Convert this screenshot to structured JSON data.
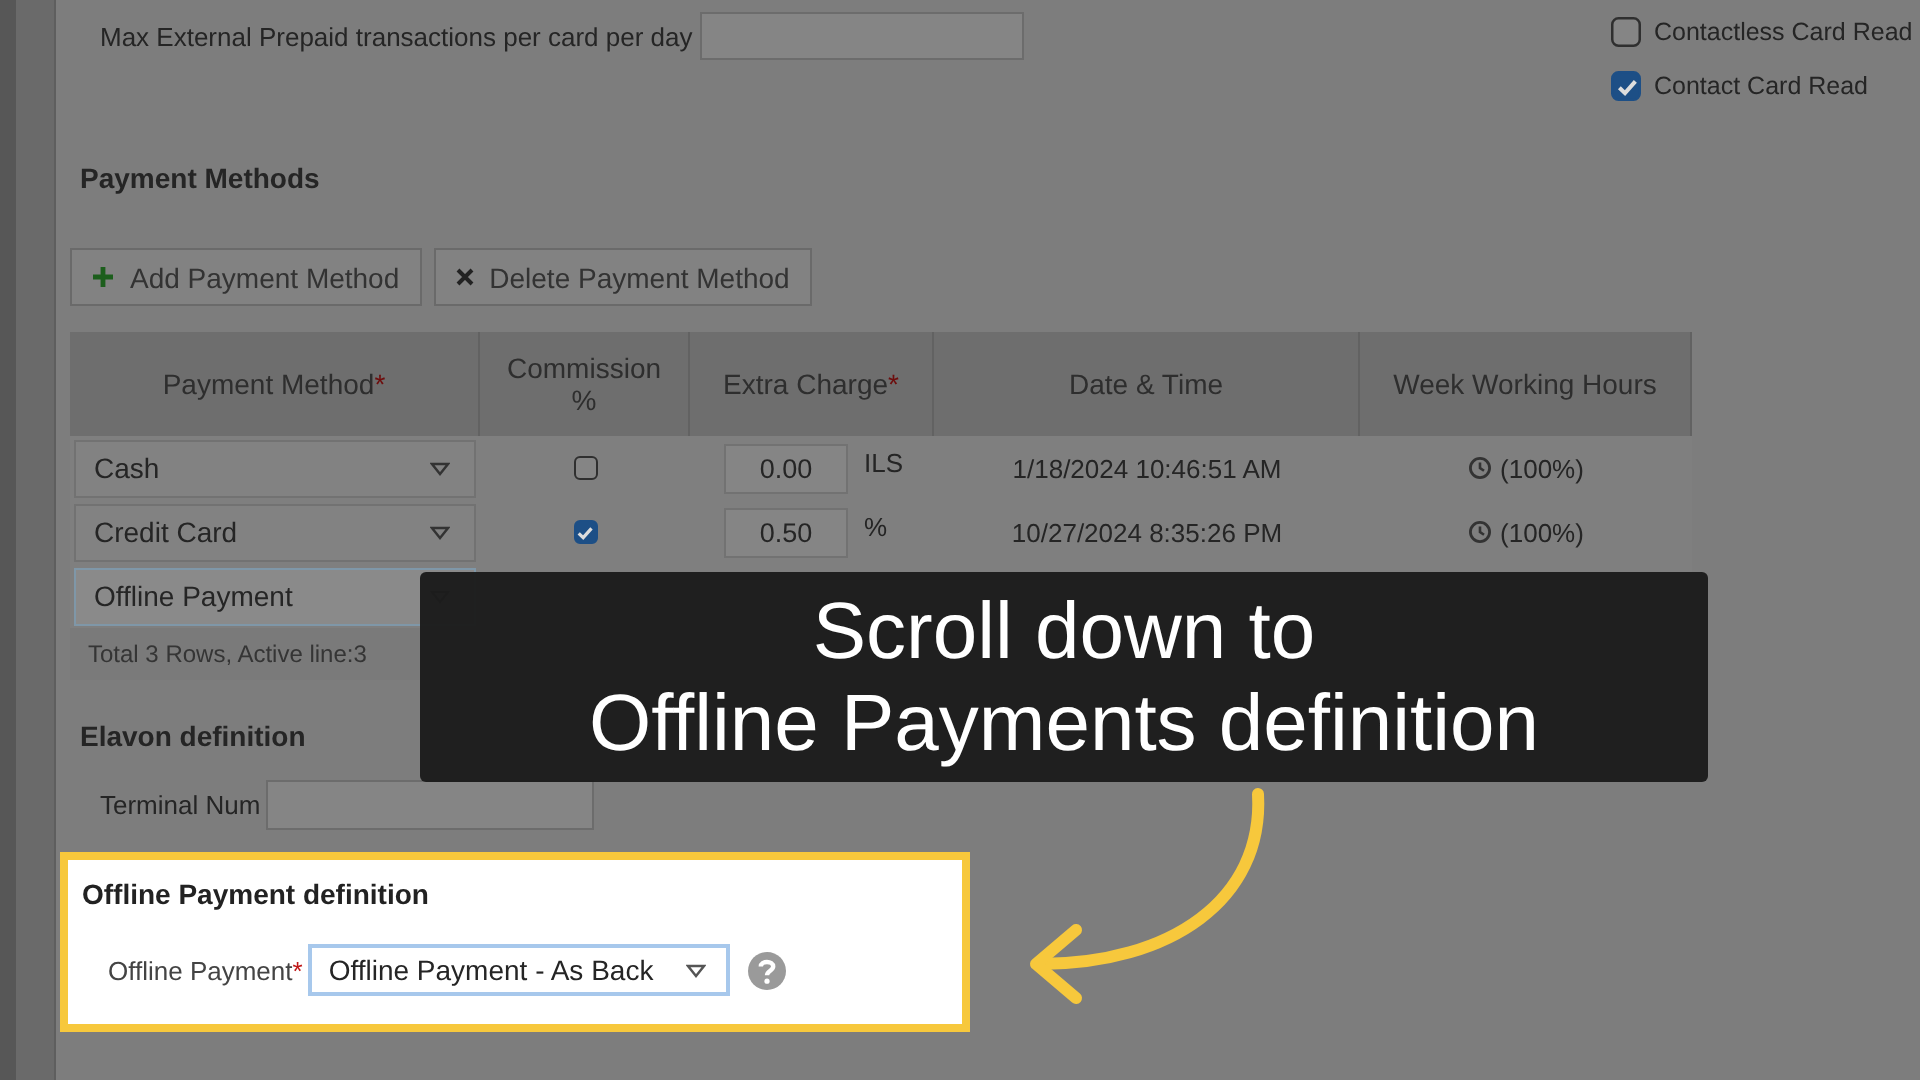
{
  "limits": {
    "label": "Max External Prepaid transactions per card per day"
  },
  "card_read_options": [
    {
      "label": "Contactless Card Read",
      "checked": false
    },
    {
      "label": "Contact Card Read",
      "checked": true
    }
  ],
  "payment_methods": {
    "title": "Payment Methods",
    "buttons": [
      {
        "label": "Add Payment Method",
        "kind": "add"
      },
      {
        "label": "Delete Payment Method",
        "kind": "delete"
      }
    ],
    "columns": [
      {
        "label": "Payment Method",
        "mark": "*"
      },
      {
        "label": "Commission %"
      },
      {
        "label": "Extra Charge",
        "mark": "*"
      },
      {
        "label": "Date & Time"
      },
      {
        "label": "Week Working Hours"
      }
    ],
    "rows": [
      {
        "method": "Cash",
        "commission": false,
        "extra_charge": "0.00",
        "unit": "ILS",
        "date_time": "1/18/2024 10:46:51 AM",
        "week_hours": "(100%)",
        "selected": false
      },
      {
        "method": "Credit Card",
        "commission": true,
        "extra_charge": "0.50",
        "unit": "%",
        "date_time": "10/27/2024 8:35:26 PM",
        "week_hours": "(100%)",
        "selected": false
      },
      {
        "method": "Offline Payment",
        "selected": true
      }
    ],
    "footer": "Total 3 Rows, Active line:3"
  },
  "elavon": {
    "title": "Elavon definition",
    "terminal_label": "Terminal Num"
  },
  "offline_payment": {
    "title": "Offline Payment definition",
    "label": "Offline Payment",
    "mark": "*",
    "value": "Offline Payment - As Back",
    "highlighted": true
  },
  "callout": {
    "lines": [
      "Scroll down to",
      "Offline Payments definition"
    ]
  }
}
